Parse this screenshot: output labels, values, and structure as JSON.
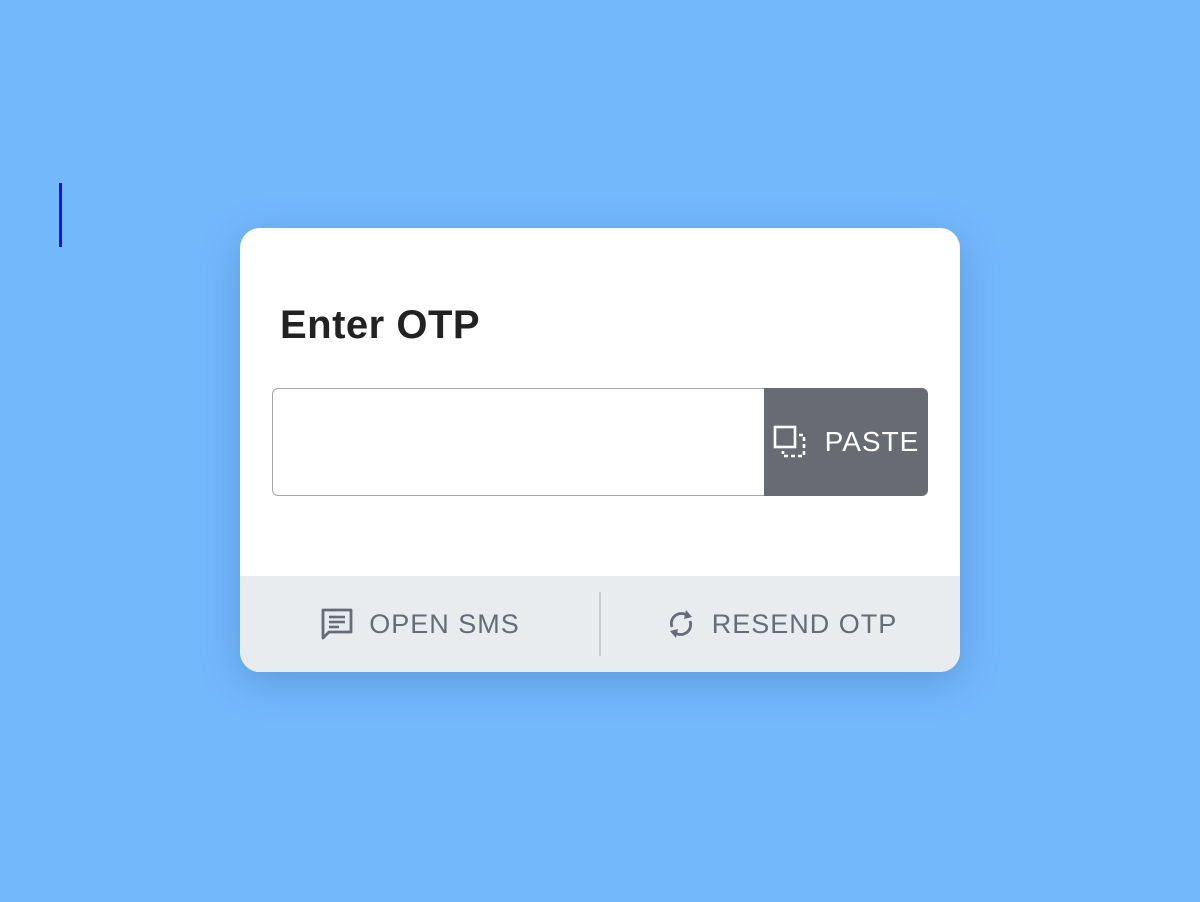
{
  "dialog": {
    "title": "Enter OTP",
    "otp_input": {
      "value": "",
      "placeholder": ""
    },
    "paste_button": {
      "label": "PASTE",
      "icon": "paste-icon"
    }
  },
  "footer": {
    "open_sms": {
      "label": "OPEN SMS",
      "icon": "message-icon"
    },
    "resend_otp": {
      "label": "RESEND OTP",
      "icon": "refresh-icon"
    }
  },
  "colors": {
    "background": "#74b8fc",
    "card": "#ffffff",
    "paste_button": "#686b73",
    "footer": "#e9ecef",
    "footer_text": "#666b75",
    "caret": "#1a10d8"
  }
}
